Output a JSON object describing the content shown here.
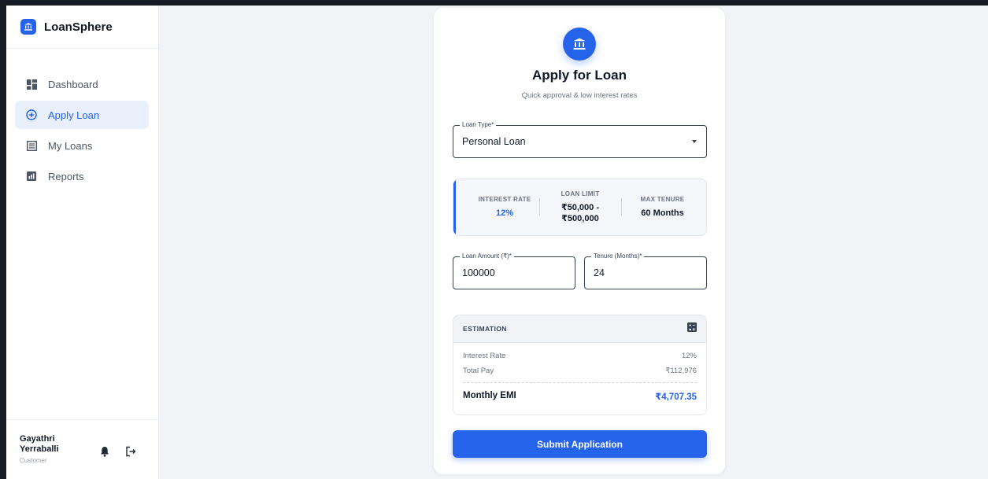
{
  "app": {
    "name": "LoanSphere",
    "brand_color": "#2563eb"
  },
  "sidebar": {
    "items": [
      {
        "label": "Dashboard",
        "icon": "dashboard-icon",
        "active": false
      },
      {
        "label": "Apply Loan",
        "icon": "plus-circle-icon",
        "active": true
      },
      {
        "label": "My Loans",
        "icon": "list-icon",
        "active": false
      },
      {
        "label": "Reports",
        "icon": "chart-icon",
        "active": false
      }
    ],
    "user": {
      "name": "Gayathri Yerraballi",
      "role": "Customer"
    }
  },
  "form": {
    "title": "Apply for Loan",
    "subtitle": "Quick approval & low interest rates",
    "loan_type": {
      "label": "Loan Type*",
      "value": "Personal Loan"
    },
    "info": {
      "interest_rate_label": "INTEREST RATE",
      "interest_rate_value": "12%",
      "loan_limit_label": "LOAN LIMIT",
      "loan_limit_min": "₹50,000 -",
      "loan_limit_max": "₹500,000",
      "max_tenure_label": "MAX TENURE",
      "max_tenure_value": "60 Months"
    },
    "loan_amount": {
      "label": "Loan Amount (₹)*",
      "value": "100000"
    },
    "tenure": {
      "label": "Tenure (Months)*",
      "value": "24"
    },
    "estimation": {
      "title": "ESTIMATION",
      "interest_rate_label": "Interest Rate",
      "interest_rate_value": "12%",
      "total_pay_label": "Total Pay",
      "total_pay_value": "₹112,976",
      "emi_label": "Monthly EMI",
      "emi_value": "₹4,707.35"
    },
    "submit_label": "Submit Application"
  }
}
